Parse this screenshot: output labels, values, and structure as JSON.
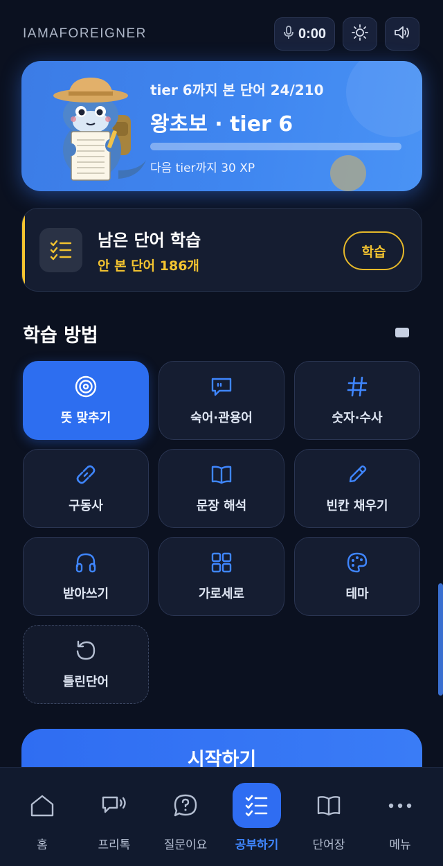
{
  "header": {
    "brand": "IAMAFOREIGNER",
    "timer": "0:00",
    "icons": [
      "mic-icon",
      "sun-icon",
      "volume-icon"
    ]
  },
  "hero": {
    "subtitle": "tier 6까지 본 단어 24/210",
    "title": "왕초보 · tier 6",
    "progress_fraction": 0.0,
    "xp_text": "다음 tier까지 30 XP"
  },
  "remaining": {
    "title": "남은 단어 학습",
    "subtitle": "안 본 단어 186개",
    "button": "학습",
    "accent": "#f4c430"
  },
  "methods": {
    "title": "학습 방법",
    "items": [
      {
        "label": "뜻 맞추기",
        "icon": "target-icon",
        "active": true
      },
      {
        "label": "숙어·관용어",
        "icon": "chat-bubble-icon",
        "active": false
      },
      {
        "label": "숫자·수사",
        "icon": "hash-icon",
        "active": false
      },
      {
        "label": "구동사",
        "icon": "link-icon",
        "active": false
      },
      {
        "label": "문장 해석",
        "icon": "book-open-icon",
        "active": false
      },
      {
        "label": "빈칸 채우기",
        "icon": "pencil-icon",
        "active": false
      },
      {
        "label": "받아쓰기",
        "icon": "headphones-icon",
        "active": false
      },
      {
        "label": "가로세로",
        "icon": "grid-icon",
        "active": false
      },
      {
        "label": "테마",
        "icon": "palette-icon",
        "active": false
      },
      {
        "label": "틀린단어",
        "icon": "retry-icon",
        "active": false
      }
    ]
  },
  "start_button": "시작하기",
  "nav": {
    "items": [
      {
        "label": "홈",
        "icon": "home-icon",
        "active": false
      },
      {
        "label": "프리톡",
        "icon": "chat-voice-icon",
        "active": false
      },
      {
        "label": "질문이요",
        "icon": "question-icon",
        "active": false
      },
      {
        "label": "공부하기",
        "icon": "checklist-icon",
        "active": true
      },
      {
        "label": "단어장",
        "icon": "book-icon",
        "active": false
      },
      {
        "label": "메뉴",
        "icon": "more-icon",
        "active": false
      }
    ]
  },
  "colors": {
    "background": "#0b1120",
    "accent_blue": "#2f6df2",
    "accent_yellow": "#f4c430",
    "icon_blue": "#3f86ff"
  }
}
